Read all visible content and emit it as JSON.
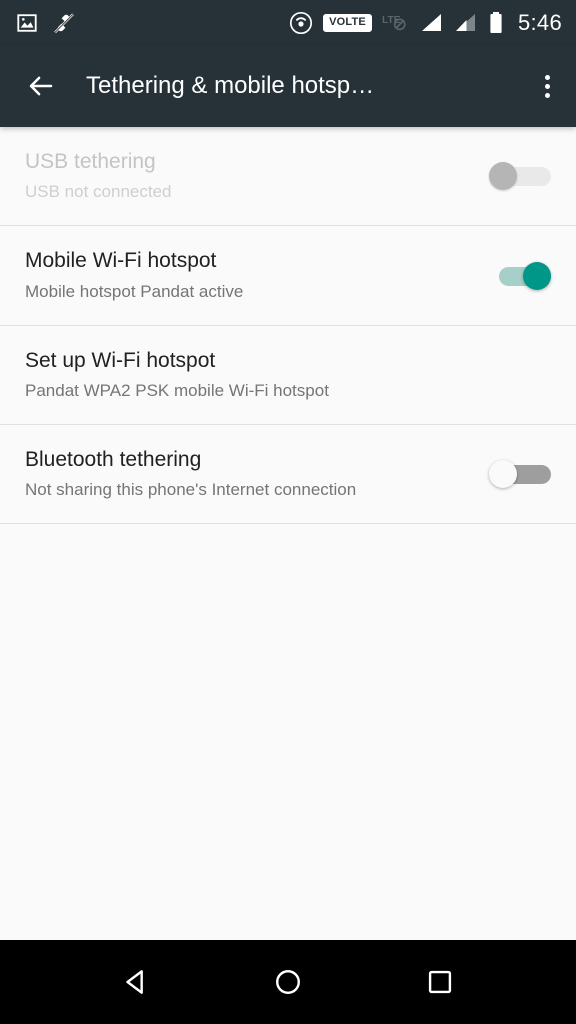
{
  "statusbar": {
    "clock": "5:46",
    "left_icons": [
      {
        "name": "screenshot-image-icon",
        "label": "image"
      },
      {
        "name": "vibrate-off-icon",
        "label": "silent"
      }
    ],
    "right_icons": [
      {
        "name": "hotspot-icon",
        "label": "hotspot active"
      },
      {
        "name": "volte-badge",
        "label": "VOLTE"
      },
      {
        "name": "lte-disabled-icon",
        "label": "LTE"
      },
      {
        "name": "signal-sim1-icon",
        "label": "signal full"
      },
      {
        "name": "signal-sim2-icon",
        "label": "signal partial"
      },
      {
        "name": "battery-icon",
        "label": "battery full"
      }
    ]
  },
  "appbar": {
    "back_label": "Back",
    "title": "Tethering & mobile hotsp…",
    "overflow_label": "More options"
  },
  "settings": {
    "rows": [
      {
        "name": "usb-tethering",
        "title": "USB tethering",
        "subtitle": "USB not connected",
        "switch": "disabled",
        "has_switch": true,
        "enabled": false
      },
      {
        "name": "mobile-wifi-hotspot",
        "title": "Mobile Wi-Fi hotspot",
        "subtitle": "Mobile hotspot Pandat active",
        "switch": "on",
        "has_switch": true,
        "enabled": true
      },
      {
        "name": "set-up-wifi-hotspot",
        "title": "Set up Wi-Fi hotspot",
        "subtitle": "Pandat WPA2 PSK mobile Wi-Fi hotspot",
        "switch": "none",
        "has_switch": false,
        "enabled": true
      },
      {
        "name": "bluetooth-tethering",
        "title": "Bluetooth tethering",
        "subtitle": "Not sharing this phone's Internet connection",
        "switch": "off",
        "has_switch": true,
        "enabled": true
      }
    ]
  },
  "navbar": {
    "back_label": "Back",
    "home_label": "Home",
    "recents_label": "Recent apps"
  },
  "colors": {
    "appbar_background": "#263238",
    "page_background": "#fafafa",
    "switch_on_accent": "#009688",
    "switch_on_track": "#a7cfca",
    "primary_text": "#212121",
    "secondary_text": "#757575",
    "disabled_text": "#c4c4c4",
    "navbar_background": "#000000",
    "divider": "#e0e0e0"
  }
}
